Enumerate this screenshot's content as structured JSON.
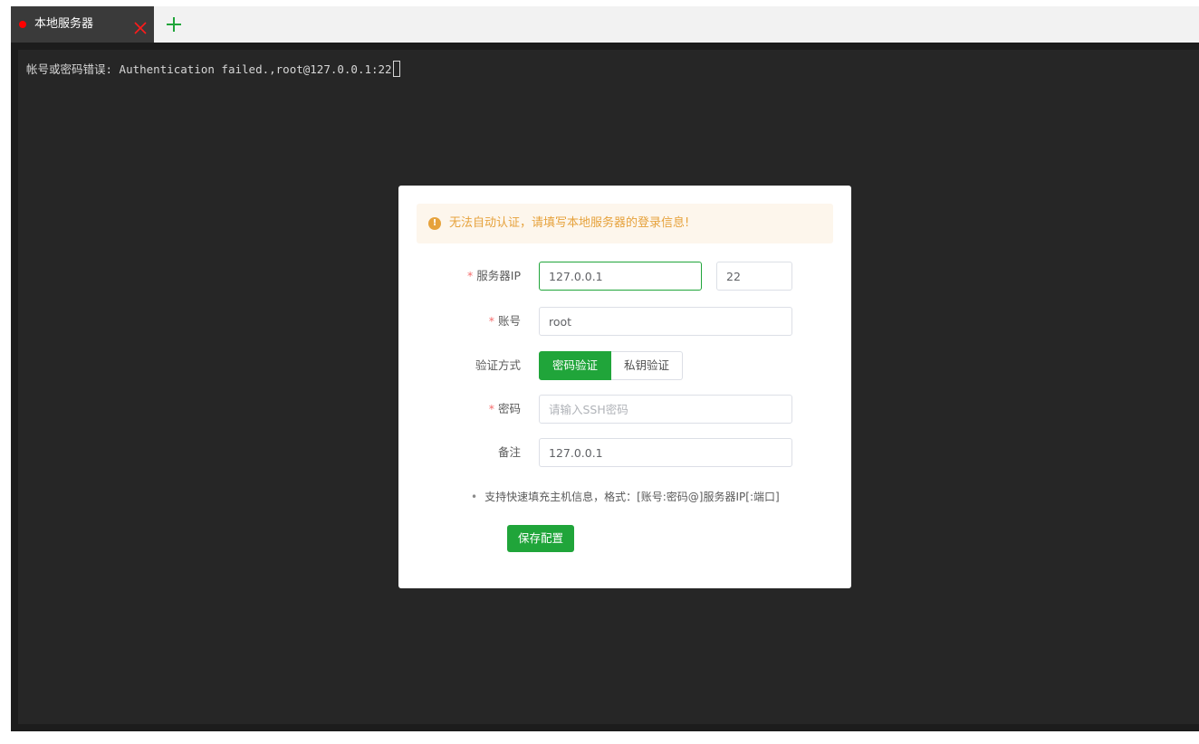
{
  "tabs": [
    {
      "label": "本地服务器",
      "status_color": "#ff0000"
    }
  ],
  "terminal": {
    "output": "帐号或密码错误: Authentication failed.,root@127.0.0.1:22"
  },
  "dialog": {
    "alert": "无法自动认证，请填写本地服务器的登录信息!",
    "fields": {
      "server_ip": {
        "label": "服务器IP",
        "value": "127.0.0.1",
        "port": "22"
      },
      "account": {
        "label": "账号",
        "value": "root"
      },
      "auth_method": {
        "label": "验证方式",
        "options": [
          "密码验证",
          "私钥验证"
        ],
        "selected": "密码验证"
      },
      "password": {
        "label": "密码",
        "placeholder": "请输入SSH密码",
        "value": ""
      },
      "remark": {
        "label": "备注",
        "value": "127.0.0.1"
      }
    },
    "hint": "支持快速填充主机信息，格式：[账号:密码@]服务器IP[:端口]",
    "save_label": "保存配置"
  },
  "colors": {
    "accent": "#20a53a",
    "warning": "#e6a23c",
    "required": "#f56c6c",
    "terminal_bg": "#262626"
  }
}
